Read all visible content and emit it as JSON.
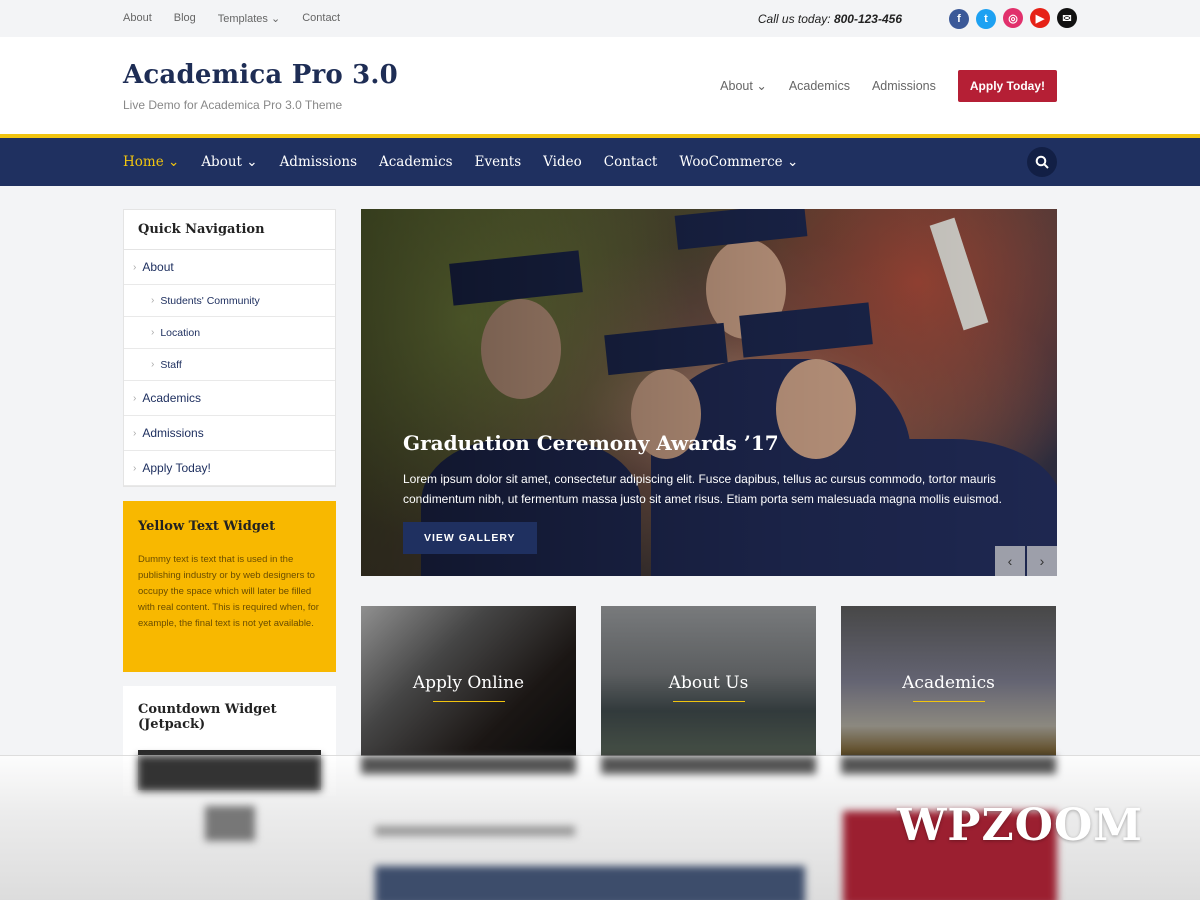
{
  "topbar": {
    "links": [
      "About",
      "Blog",
      "Templates",
      "Contact"
    ],
    "call_label": "Call us today:",
    "phone": "800-123-456",
    "social": [
      {
        "name": "facebook-icon",
        "glyph": "f",
        "color": "#3b5998"
      },
      {
        "name": "twitter-icon",
        "glyph": "t",
        "color": "#1da1f2"
      },
      {
        "name": "instagram-icon",
        "glyph": "◎",
        "color": "#e1306c"
      },
      {
        "name": "youtube-icon",
        "glyph": "▶",
        "color": "#e62117"
      },
      {
        "name": "email-icon",
        "glyph": "✉",
        "color": "#111111"
      }
    ]
  },
  "header": {
    "title": "Academica Pro 3.0",
    "subtitle": "Live Demo for Academica Pro 3.0 Theme",
    "nav": [
      "About",
      "Academics",
      "Admissions"
    ],
    "cta": "Apply Today!"
  },
  "mainnav": {
    "items": [
      "Home",
      "About",
      "Admissions",
      "Academics",
      "Events",
      "Video",
      "Contact",
      "WooCommerce"
    ]
  },
  "sidebar": {
    "quick_nav_title": "Quick Navigation",
    "quick_nav": [
      {
        "label": "About",
        "sub": false
      },
      {
        "label": "Students' Community",
        "sub": true
      },
      {
        "label": "Location",
        "sub": true
      },
      {
        "label": "Staff",
        "sub": true
      },
      {
        "label": "Academics",
        "sub": false
      },
      {
        "label": "Admissions",
        "sub": false
      },
      {
        "label": "Apply Today!",
        "sub": false
      }
    ],
    "yellow_title": "Yellow Text Widget",
    "yellow_text": "Dummy text is text that is used in the publishing industry or by web designers to occupy the space which will later be filled with real content. This is required when, for example, the final text is not yet available.",
    "countdown_title": "Countdown Widget (Jetpack)"
  },
  "hero": {
    "title": "Graduation Ceremony Awards ’17",
    "text": "Lorem ipsum dolor sit amet, consectetur adipiscing elit. Fusce dapibus, tellus ac cursus commodo, tortor mauris condimentum nibh, ut fermentum massa justo sit amet risus. Etiam porta sem malesuada magna mollis euismod.",
    "button": "VIEW GALLERY"
  },
  "cards": [
    "Apply Online",
    "About Us",
    "Academics"
  ],
  "watermark": "WPZOOM"
}
